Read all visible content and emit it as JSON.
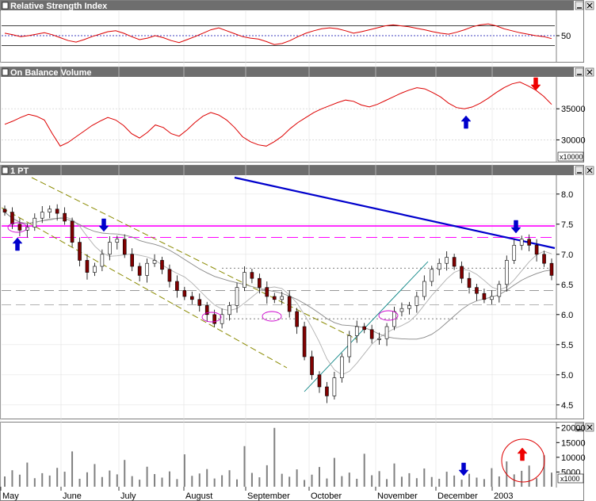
{
  "panels": {
    "rsi": {
      "title": "Relative Strength Index"
    },
    "obv": {
      "title": "On Balance Volume"
    },
    "price": {
      "title": "1 PT"
    }
  },
  "colors": {
    "header_bg": "#6e6e6e",
    "grid": "#c8c8c8",
    "obv_line": "#dd0000",
    "rsi_line": "#dd0000",
    "trendline": "#0000cc",
    "resistance": "#ff00ff",
    "channel": "#8a8a00",
    "up_candle": "#ffffff",
    "down_candle": "#800000",
    "volume": "#808080",
    "arrow_blue": "#0000cc",
    "arrow_red": "#ee0000"
  },
  "chart_data": [
    {
      "type": "line",
      "name": "Relative Strength Index",
      "y_tick_labels": [
        "50"
      ],
      "ylim": [
        0,
        100
      ],
      "reference_lines": [
        30,
        50,
        70
      ],
      "values": [
        55,
        52,
        48,
        50,
        53,
        56,
        52,
        46,
        40,
        37,
        42,
        48,
        53,
        58,
        60,
        55,
        48,
        42,
        45,
        50,
        46,
        40,
        36,
        42,
        48,
        55,
        62,
        66,
        60,
        54,
        48,
        45,
        43,
        38,
        32,
        34,
        40,
        48,
        55,
        60,
        64,
        66,
        64,
        60,
        55,
        58,
        62,
        66,
        70,
        72,
        70,
        68,
        65,
        62,
        58,
        55,
        53,
        57,
        62,
        68,
        72,
        74,
        70,
        64,
        60,
        56,
        53,
        50,
        48,
        44
      ]
    },
    {
      "type": "line",
      "name": "On Balance Volume",
      "y_tick_labels": [
        "30000",
        "35000"
      ],
      "y_unit_label": "x10000",
      "ylim": [
        27000,
        40000
      ],
      "values": [
        32500,
        33000,
        33600,
        34100,
        33800,
        33200,
        31000,
        29000,
        29600,
        30500,
        31400,
        32300,
        33000,
        33600,
        33200,
        32300,
        31000,
        30300,
        31200,
        32400,
        32000,
        31000,
        30600,
        31600,
        32800,
        33800,
        34400,
        34000,
        33200,
        32000,
        30500,
        29700,
        29200,
        29000,
        29700,
        30600,
        31800,
        32800,
        33600,
        34400,
        35000,
        35500,
        36000,
        36400,
        36200,
        35600,
        35300,
        35700,
        36300,
        36900,
        37500,
        38000,
        38400,
        38200,
        37600,
        36900,
        35900,
        35200,
        35000,
        35300,
        35900,
        36700,
        37600,
        38400,
        39000,
        39300,
        38700,
        38000,
        37000,
        35700
      ]
    },
    {
      "type": "line",
      "name": "1 PT",
      "y_tick_labels": [
        "4.5",
        "5.0",
        "5.5",
        "6.0",
        "6.5",
        "7.0",
        "7.5",
        "8.0"
      ],
      "ylim": [
        4.3,
        8.3
      ],
      "resistance_levels": [
        7.47,
        7.28,
        6.77,
        6.4,
        6.16,
        5.93
      ],
      "values": [
        7.7,
        7.5,
        7.4,
        7.45,
        7.6,
        7.7,
        7.75,
        7.68,
        7.55,
        7.2,
        6.9,
        6.7,
        6.8,
        7.0,
        7.2,
        7.25,
        7.0,
        6.8,
        6.65,
        6.85,
        6.9,
        6.75,
        6.55,
        6.4,
        6.3,
        6.25,
        6.15,
        6.0,
        5.85,
        6.0,
        6.15,
        6.45,
        6.7,
        6.6,
        6.45,
        6.3,
        6.25,
        6.3,
        6.05,
        5.8,
        5.3,
        5.0,
        4.8,
        4.65,
        4.95,
        5.3,
        5.65,
        5.8,
        5.75,
        5.6,
        5.6,
        5.8,
        6.05,
        6.1,
        6.15,
        6.3,
        6.55,
        6.75,
        6.85,
        6.95,
        6.8,
        6.6,
        6.45,
        6.35,
        6.25,
        6.3,
        6.5,
        6.9,
        7.15,
        7.25,
        7.15,
        7.0,
        6.85,
        6.65
      ]
    },
    {
      "type": "bar",
      "name": "Volume",
      "y_tick_labels": [
        "5000",
        "10000",
        "15000",
        "20000"
      ],
      "y_unit_label": "x1000",
      "ylim": [
        0,
        21000
      ],
      "values": [
        3500,
        5600,
        4100,
        8200,
        2900,
        4600,
        3800,
        6400,
        5100,
        12000,
        2700,
        4900,
        7700,
        3300,
        5500,
        4200,
        9100,
        3600,
        2400,
        6800,
        4300,
        3100,
        5200,
        2600,
        11000,
        3700,
        4500,
        6000,
        2800,
        3900,
        5600,
        2500,
        13800,
        4700,
        3200,
        7300,
        20000,
        4400,
        3400,
        5900,
        2300,
        4100,
        6700,
        2800,
        9800,
        3600,
        4800,
        2700,
        11200,
        3900,
        5300,
        2600,
        7900,
        3400,
        4600,
        2900,
        6200,
        3300,
        2700,
        5100,
        3800,
        2400,
        4400,
        3100,
        2600,
        6300,
        3500,
        8600,
        4200,
        5400,
        7200,
        2900,
        10700,
        4800
      ]
    }
  ],
  "x_axis": {
    "month_labels": [
      "May",
      "June",
      "July",
      "August",
      "September",
      "October",
      "November",
      "December",
      "2003"
    ]
  }
}
